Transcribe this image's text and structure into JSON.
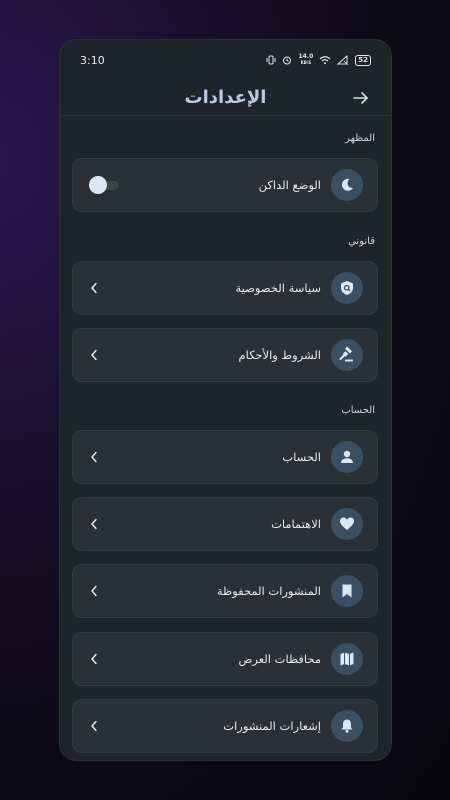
{
  "status_bar": {
    "time": "3:10",
    "net_speed_value": "14.0",
    "net_speed_unit": "KB/S",
    "battery": "52"
  },
  "header": {
    "title": "الإعدادات"
  },
  "sections": {
    "appearance": "المظهر",
    "legal": "قانوني",
    "account": "الحساب"
  },
  "items": {
    "dark_mode": "الوضع الداكن",
    "privacy_policy": "سياسة الخصوصية",
    "terms": "الشروط والأحكام",
    "account": "الحساب",
    "interests": "الاهتمامات",
    "saved_posts": "المنشورات المحفوظة",
    "provinces": "محافظات العرض",
    "post_notifications": "إشعارات المنشورات"
  },
  "toggles": {
    "dark_mode_on": false
  },
  "colors": {
    "accent": "#b7cbe6",
    "icon_circle": "#3a4f63",
    "card": "#2b3036",
    "panel": "#1f2429"
  },
  "icons": {
    "dark_mode": "moon-icon",
    "privacy_policy": "shield-search-icon",
    "terms": "gavel-icon",
    "account": "person-icon",
    "interests": "heart-icon",
    "saved_posts": "bookmark-icon",
    "provinces": "map-icon",
    "post_notifications": "bell-icon"
  }
}
